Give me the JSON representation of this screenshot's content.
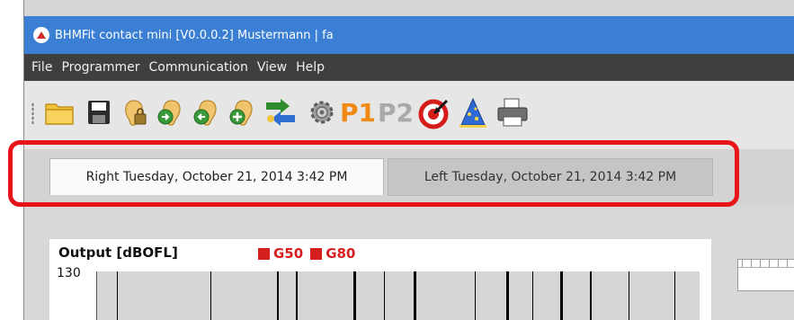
{
  "window": {
    "title": "BHMFit contact mini [V0.0.0.2] Mustermann | fa"
  },
  "menu": [
    "File",
    "Programmer",
    "Communication",
    "View",
    "Help"
  ],
  "toolbar": {
    "icons": [
      "open-folder-icon",
      "save-disk-icon",
      "ear-lock-icon",
      "ear-right-arrow-icon",
      "ear-left-arrow-icon",
      "ear-plus-icon",
      "sync-arrows-icon",
      "settings-gear-icon",
      "p1-icon",
      "p2-icon",
      "target-icon",
      "wizard-hat-icon",
      "printer-icon"
    ],
    "p1_label": "P1",
    "p2_label": "P2"
  },
  "tabs": [
    {
      "label": "Right Tuesday, October 21, 2014 3:42 PM",
      "active": true
    },
    {
      "label": "Left Tuesday, October 21, 2014 3:42 PM",
      "active": false
    }
  ],
  "chart": {
    "title": "Output [dBOFL]",
    "legend": [
      {
        "label": "G50",
        "color": "#d51f1f"
      },
      {
        "label": "G80",
        "color": "#d51f1f"
      }
    ],
    "y_top_tick": "130"
  }
}
